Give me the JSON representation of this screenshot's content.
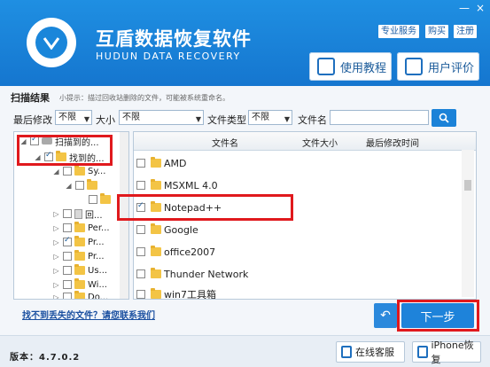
{
  "app": {
    "title_cn": "互盾数据恢复软件",
    "title_en": "HUDUN DATA RECOVERY",
    "top_links": [
      "专业服务",
      "购买",
      "注册"
    ],
    "window_controls": [
      "—",
      "×"
    ],
    "header_buttons": [
      "使用教程",
      "用户评价"
    ]
  },
  "results": {
    "label": "扫描结果",
    "tip": "小提示：描过回收站删除的文件，可能被系统重命名。"
  },
  "filters": {
    "modified_label": "最后修改",
    "modified_value": "不限",
    "size_label": "大小",
    "size_value": "不限",
    "type_label": "文件类型",
    "type_value": "不限",
    "name_label": "文件名",
    "name_value": ""
  },
  "tree": [
    {
      "label": "扫描到的...",
      "checked": true
    },
    {
      "label": "找到的...",
      "checked": true
    },
    {
      "label": "Sy...",
      "checked": false
    },
    {
      "label": "",
      "checked": false
    },
    {
      "label": "",
      "checked": false
    },
    {
      "label": "回...",
      "checked": false
    },
    {
      "label": "Per...",
      "checked": false
    },
    {
      "label": "Pr...",
      "checked": true
    },
    {
      "label": "Pr...",
      "checked": false
    },
    {
      "label": "Us...",
      "checked": false
    },
    {
      "label": "Wi...",
      "checked": false
    },
    {
      "label": "Do...",
      "checked": false
    }
  ],
  "file_list": {
    "columns": [
      "文件名",
      "文件大小",
      "最后修改时间"
    ],
    "rows": [
      {
        "name": "AMD",
        "checked": false
      },
      {
        "name": "MSXML 4.0",
        "checked": false
      },
      {
        "name": "Notepad++",
        "checked": true
      },
      {
        "name": "Google",
        "checked": false
      },
      {
        "name": "office2007",
        "checked": false
      },
      {
        "name": "Thunder Network",
        "checked": false
      },
      {
        "name": "win7工具箱",
        "checked": false
      }
    ]
  },
  "bottom": {
    "lost_link": "找不到丢失的文件？请您联系我们",
    "next_label": "下一步",
    "version": "版本：4.7.0.2",
    "footer_buttons": [
      "在线客服",
      "iPhone恢复"
    ]
  },
  "colors": {
    "accent": "#1e83da",
    "highlight": "#e0191d"
  }
}
